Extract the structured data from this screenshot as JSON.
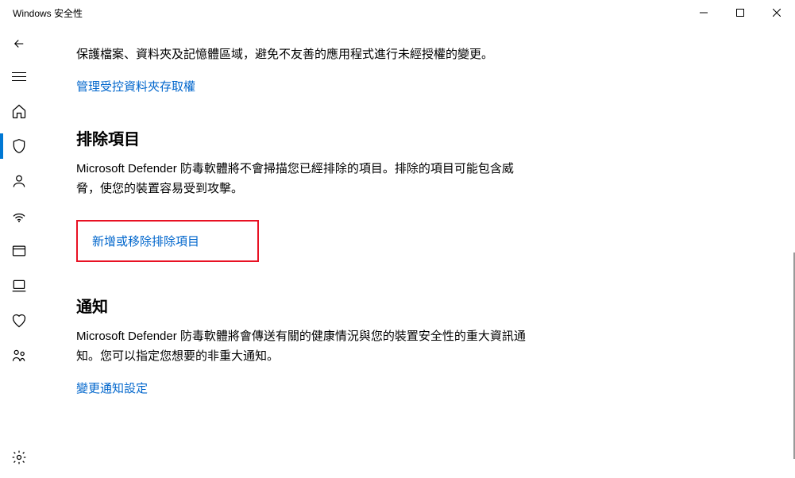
{
  "window": {
    "title": "Windows 安全性"
  },
  "controls": {
    "minimize": "─",
    "maximize": "☐",
    "close": "✕"
  },
  "content": {
    "intro_desc": "保護檔案、資料夾及記憶體區域，避免不友善的應用程式進行未經授權的變更。",
    "intro_link": "管理受控資料夾存取權",
    "exclusions": {
      "heading": "排除項目",
      "desc": "Microsoft Defender 防毒軟體將不會掃描您已經排除的項目。排除的項目可能包含威脅，使您的裝置容易受到攻擊。",
      "link": "新增或移除排除項目"
    },
    "notifications": {
      "heading": "通知",
      "desc": "Microsoft Defender 防毒軟體將會傳送有關的健康情況與您的裝置安全性的重大資訊通知。您可以指定您想要的非重大通知。",
      "link": "變更通知設定"
    }
  }
}
